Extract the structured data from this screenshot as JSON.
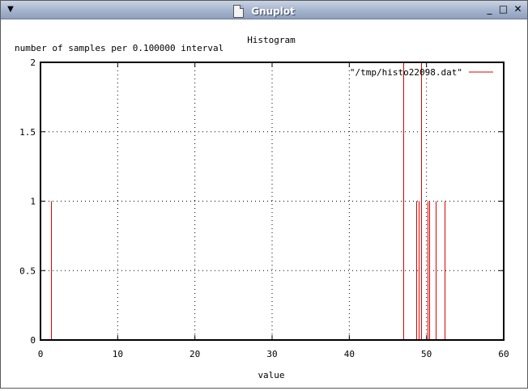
{
  "window": {
    "title": "Gnuplot",
    "menu_icon": "chevron-down-icon",
    "app_icon": "document-icon",
    "controls": {
      "minimize": "_",
      "maximize": "□",
      "close": "✕"
    }
  },
  "chart_data": {
    "type": "bar",
    "title": "Histogram",
    "ylabel": "number of samples per 0.100000 interval",
    "xlabel": "value",
    "xlim": [
      0,
      60
    ],
    "ylim": [
      0,
      2
    ],
    "xticks": [
      0,
      10,
      20,
      30,
      40,
      50,
      60
    ],
    "xtick_labels": [
      "0",
      "10",
      "20",
      "30",
      "40",
      "50",
      "60"
    ],
    "yticks": [
      0,
      0.5,
      1,
      1.5,
      2
    ],
    "ytick_labels": [
      "0",
      "0.5",
      "1",
      "1.5",
      "2"
    ],
    "grid": true,
    "legend_position": "top-right",
    "series": [
      {
        "name": "\"/tmp/histo22098.dat\"",
        "color": "#e00000",
        "style": "impulses",
        "x": [
          1.4,
          47.0,
          48.7,
          49.0,
          49.3,
          50.1,
          50.4,
          51.2,
          52.3
        ],
        "values": [
          1,
          2,
          1,
          1,
          2,
          1,
          1,
          1,
          1
        ]
      }
    ]
  }
}
